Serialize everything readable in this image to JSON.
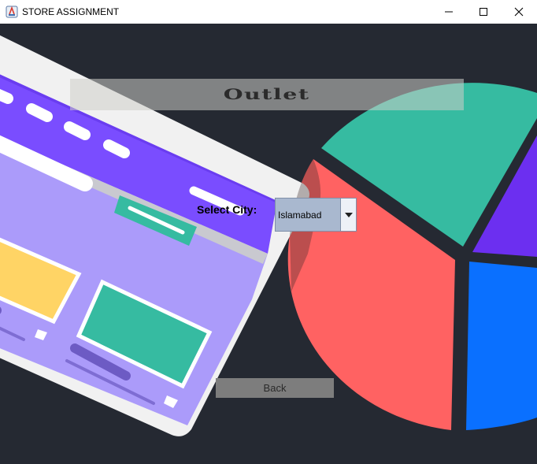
{
  "window": {
    "title": "STORE ASSIGNMENT"
  },
  "banner": {
    "title": "Outlet"
  },
  "city": {
    "label": "Select City:",
    "selected": "Islamabad"
  },
  "back_button": {
    "label": "Back"
  },
  "colors": {
    "background": "#252932",
    "pie_green": "#36bba1",
    "pie_red": "#ff6262",
    "pie_purple": "#6c2ff0",
    "pie_blue": "#0a70ff",
    "tablet_purple": "#7c4dff",
    "tablet_light": "#ab9bfa",
    "tablet_yellow": "#ffd465"
  },
  "icons": [
    "app-icon",
    "minimize-icon",
    "maximize-icon",
    "close-icon",
    "dropdown-arrow-icon"
  ]
}
